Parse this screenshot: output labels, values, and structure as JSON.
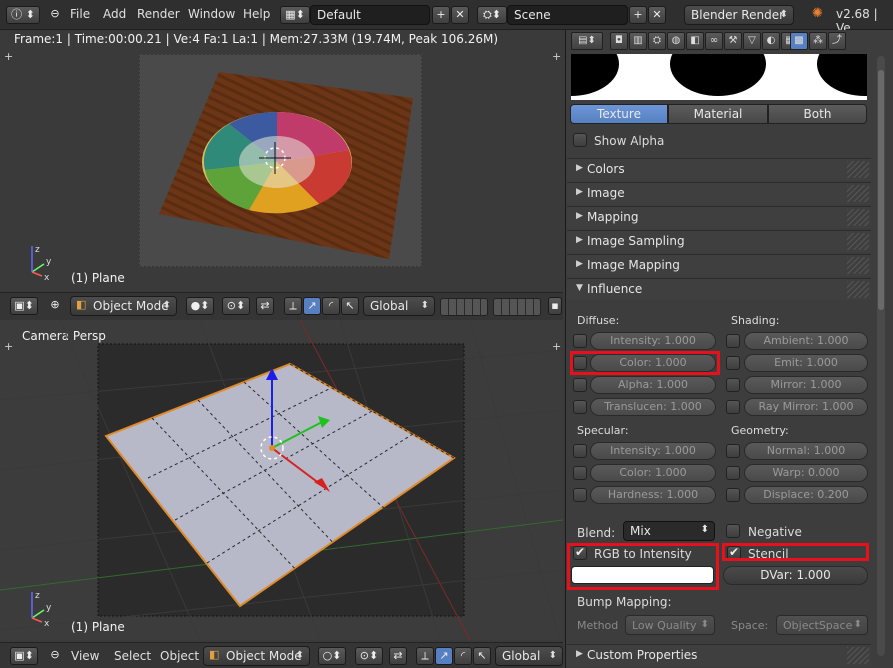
{
  "topbar": {
    "menus": [
      "File",
      "Add",
      "Render",
      "Window",
      "Help"
    ],
    "screen_layout": "Default",
    "scene": "Scene",
    "render_engine": "Blender Render",
    "version": "v2.68 | Ve"
  },
  "top_viewport": {
    "stats": "Frame:1 | Time:00:00.21 | Ve:4 Fa:1 La:1 | Mem:27.33M (19.74M, Peak 106.26M)",
    "object_label": "(1) Plane",
    "mode": "Object Mode",
    "orientation": "Global"
  },
  "bottom_viewport": {
    "view_label": "Camera Persp",
    "object_label": "(1) Plane",
    "menus": [
      "View",
      "Select",
      "Object"
    ],
    "mode": "Object Mode",
    "orientation": "Global"
  },
  "properties": {
    "preview_tabs": [
      "Texture",
      "Material",
      "Both"
    ],
    "active_tab": "Texture",
    "show_alpha": "Show Alpha",
    "panels": [
      "Colors",
      "Image",
      "Mapping",
      "Image Sampling",
      "Image Mapping",
      "Influence"
    ],
    "diffuse": {
      "heading": "Diffuse:",
      "items": [
        "Intensity: 1.000",
        "Color: 1.000",
        "Alpha: 1.000",
        "Translucen: 1.000"
      ]
    },
    "shading": {
      "heading": "Shading:",
      "items": [
        "Ambient: 1.000",
        "Emit: 1.000",
        "Mirror: 1.000",
        "Ray Mirror: 1.000"
      ]
    },
    "specular": {
      "heading": "Specular:",
      "items": [
        "Intensity: 1.000",
        "Color: 1.000",
        "Hardness: 1.000"
      ]
    },
    "geometry": {
      "heading": "Geometry:",
      "items": [
        "Normal: 1.000",
        "Warp: 0.000",
        "Displace: 0.200"
      ]
    },
    "blend_label": "Blend:",
    "blend_value": "Mix",
    "negative": "Negative",
    "rgb_to_intensity": "RGB to Intensity",
    "stencil": "Stencil",
    "dvar": "DVar: 1.000",
    "bump_mapping": "Bump Mapping:",
    "method_label": "Method",
    "method_value": "Low Quality",
    "space_label": "Space:",
    "space_value": "ObjectSpace",
    "custom_properties": "Custom Properties"
  },
  "colors": {
    "accent_blue": "#5680c2",
    "highlight_red": "#e8101a"
  }
}
